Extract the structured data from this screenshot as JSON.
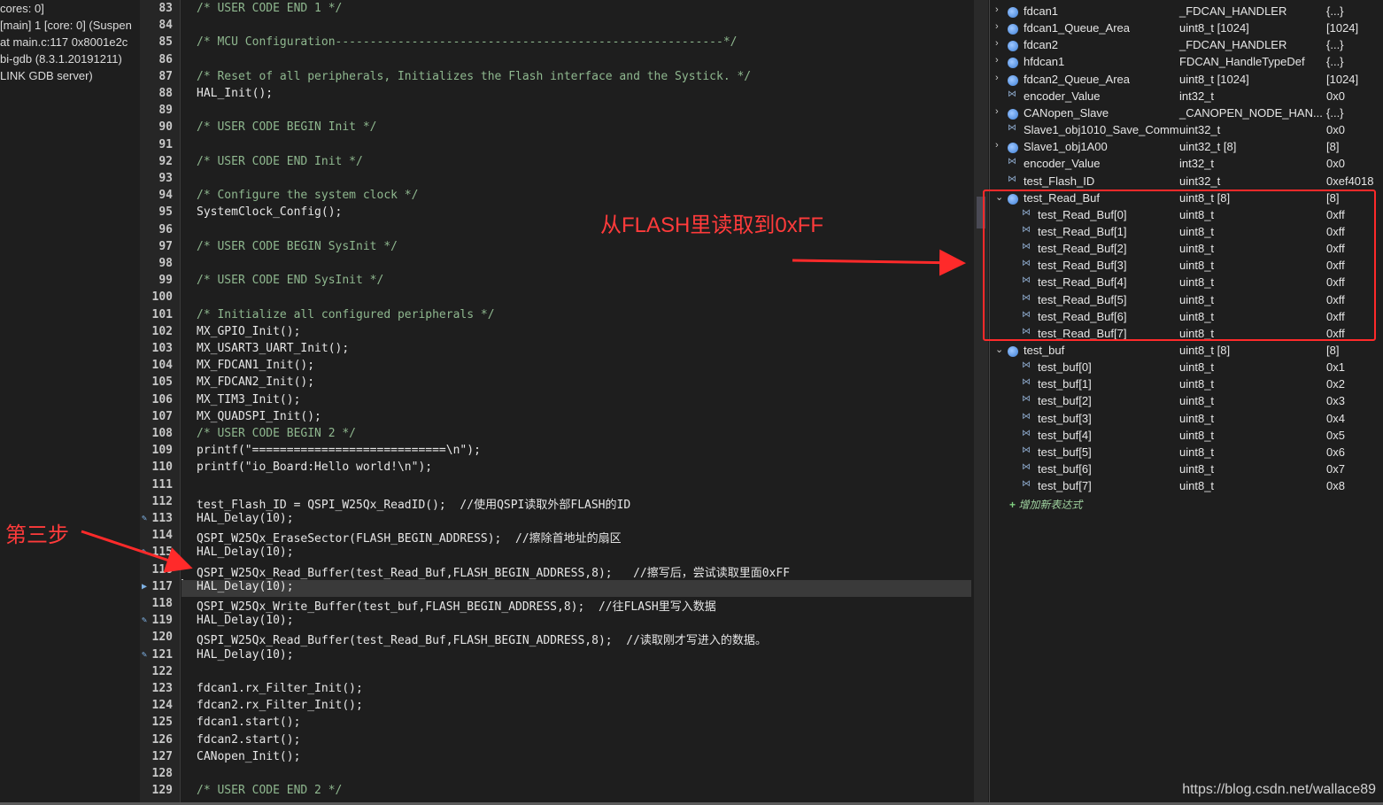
{
  "debug": {
    "lines": [
      "cores: 0]",
      "[main] 1 [core: 0] (Suspen",
      "at main.c:117 0x8001e2c",
      "bi-gdb (8.3.1.20191211)",
      "LINK GDB server)"
    ]
  },
  "editor": {
    "lines": [
      {
        "n": "83",
        "code": "/* USER CODE END 1 */",
        "kind": "comment"
      },
      {
        "n": "84",
        "code": "",
        "kind": "code"
      },
      {
        "n": "85",
        "code": "/* MCU Configuration--------------------------------------------------------*/",
        "kind": "comment"
      },
      {
        "n": "86",
        "code": "",
        "kind": "code"
      },
      {
        "n": "87",
        "code": "/* Reset of all peripherals, Initializes the Flash interface and the Systick. */",
        "kind": "comment"
      },
      {
        "n": "88",
        "code": "HAL_Init();",
        "kind": "code"
      },
      {
        "n": "89",
        "code": "",
        "kind": "code"
      },
      {
        "n": "90",
        "code": "/* USER CODE BEGIN Init */",
        "kind": "comment"
      },
      {
        "n": "91",
        "code": "",
        "kind": "code"
      },
      {
        "n": "92",
        "code": "/* USER CODE END Init */",
        "kind": "comment"
      },
      {
        "n": "93",
        "code": "",
        "kind": "code"
      },
      {
        "n": "94",
        "code": "/* Configure the system clock */",
        "kind": "comment"
      },
      {
        "n": "95",
        "code": "SystemClock_Config();",
        "kind": "code"
      },
      {
        "n": "96",
        "code": "",
        "kind": "code"
      },
      {
        "n": "97",
        "code": "/* USER CODE BEGIN SysInit */",
        "kind": "comment"
      },
      {
        "n": "98",
        "code": "",
        "kind": "code"
      },
      {
        "n": "99",
        "code": "/* USER CODE END SysInit */",
        "kind": "comment"
      },
      {
        "n": "100",
        "code": "",
        "kind": "code"
      },
      {
        "n": "101",
        "code": "/* Initialize all configured peripherals */",
        "kind": "comment"
      },
      {
        "n": "102",
        "code": "MX_GPIO_Init();",
        "kind": "code"
      },
      {
        "n": "103",
        "code": "MX_USART3_UART_Init();",
        "kind": "code"
      },
      {
        "n": "104",
        "code": "MX_FDCAN1_Init();",
        "kind": "code"
      },
      {
        "n": "105",
        "code": "MX_FDCAN2_Init();",
        "kind": "code"
      },
      {
        "n": "106",
        "code": "MX_TIM3_Init();",
        "kind": "code"
      },
      {
        "n": "107",
        "code": "MX_QUADSPI_Init();",
        "kind": "code"
      },
      {
        "n": "108",
        "code": "/* USER CODE BEGIN 2 */",
        "kind": "comment"
      },
      {
        "n": "109",
        "code": "printf(\"============================\\n\");",
        "kind": "code"
      },
      {
        "n": "110",
        "code": "printf(\"io_Board:Hello world!\\n\");",
        "kind": "code"
      },
      {
        "n": "111",
        "code": "",
        "kind": "code"
      },
      {
        "n": "112",
        "code": "test_Flash_ID = QSPI_W25Qx_ReadID();  //使用QSPI读取外部FLASH的ID",
        "kind": "code"
      },
      {
        "n": "113",
        "code": "HAL_Delay(10);",
        "kind": "code",
        "mark": true
      },
      {
        "n": "114",
        "code": "QSPI_W25Qx_EraseSector(FLASH_BEGIN_ADDRESS);  //擦除首地址的扇区",
        "kind": "code"
      },
      {
        "n": "115",
        "code": "HAL_Delay(10);",
        "kind": "code",
        "mark": true
      },
      {
        "n": "116",
        "code": "QSPI_W25Qx_Read_Buffer(test_Read_Buf,FLASH_BEGIN_ADDRESS,8);   //擦写后，尝试读取里面0xFF",
        "kind": "code"
      },
      {
        "n": "117",
        "code": "HAL_Delay(10);",
        "kind": "current",
        "mark": true
      },
      {
        "n": "118",
        "code": "QSPI_W25Qx_Write_Buffer(test_buf,FLASH_BEGIN_ADDRESS,8);  //往FLASH里写入数据",
        "kind": "code"
      },
      {
        "n": "119",
        "code": "HAL_Delay(10);",
        "kind": "code",
        "mark": true
      },
      {
        "n": "120",
        "code": "QSPI_W25Qx_Read_Buffer(test_Read_Buf,FLASH_BEGIN_ADDRESS,8);  //读取刚才写进入的数据。",
        "kind": "code"
      },
      {
        "n": "121",
        "code": "HAL_Delay(10);",
        "kind": "code",
        "mark": true
      },
      {
        "n": "122",
        "code": "",
        "kind": "code"
      },
      {
        "n": "123",
        "code": "fdcan1.rx_Filter_Init();",
        "kind": "code"
      },
      {
        "n": "124",
        "code": "fdcan2.rx_Filter_Init();",
        "kind": "code"
      },
      {
        "n": "125",
        "code": "fdcan1.start();",
        "kind": "code"
      },
      {
        "n": "126",
        "code": "fdcan2.start();",
        "kind": "code"
      },
      {
        "n": "127",
        "code": "CANopen_Init();",
        "kind": "code"
      },
      {
        "n": "128",
        "code": "",
        "kind": "code"
      },
      {
        "n": "129",
        "code": "/* USER CODE END 2 */",
        "kind": "comment"
      }
    ]
  },
  "expressions": {
    "rows": [
      {
        "name": "fdcan1",
        "type": "_FDCAN_HANDLER",
        "value": "{...}",
        "icon": "obj",
        "twisty": "collapsed",
        "child": false
      },
      {
        "name": "fdcan1_Queue_Area",
        "type": "uint8_t [1024]",
        "value": "[1024]",
        "icon": "obj",
        "twisty": "collapsed",
        "child": false
      },
      {
        "name": "fdcan2",
        "type": "_FDCAN_HANDLER",
        "value": "{...}",
        "icon": "obj",
        "twisty": "collapsed",
        "child": false
      },
      {
        "name": "hfdcan1",
        "type": "FDCAN_HandleTypeDef",
        "value": "{...}",
        "icon": "obj",
        "twisty": "collapsed",
        "child": false
      },
      {
        "name": "fdcan2_Queue_Area",
        "type": "uint8_t [1024]",
        "value": "[1024]",
        "icon": "obj",
        "twisty": "collapsed",
        "child": false
      },
      {
        "name": "encoder_Value",
        "type": "int32_t",
        "value": "0x0",
        "icon": "var",
        "twisty": "none",
        "child": false
      },
      {
        "name": "CANopen_Slave",
        "type": "_CANOPEN_NODE_HAN...",
        "value": "{...}",
        "icon": "obj",
        "twisty": "collapsed",
        "child": false
      },
      {
        "name": "Slave1_obj1010_Save_Comm",
        "type": "uint32_t",
        "value": "0x0",
        "icon": "var",
        "twisty": "none",
        "child": false
      },
      {
        "name": "Slave1_obj1A00",
        "type": "uint32_t [8]",
        "value": "[8]",
        "icon": "obj",
        "twisty": "collapsed",
        "child": false
      },
      {
        "name": "encoder_Value",
        "type": "int32_t",
        "value": "0x0",
        "icon": "var",
        "twisty": "none",
        "child": false
      },
      {
        "name": "test_Flash_ID",
        "type": "uint32_t",
        "value": "0xef4018",
        "icon": "var",
        "twisty": "none",
        "child": false
      },
      {
        "name": "test_Read_Buf",
        "type": "uint8_t [8]",
        "value": "[8]",
        "icon": "obj",
        "twisty": "expanded",
        "child": false
      },
      {
        "name": "test_Read_Buf[0]",
        "type": "uint8_t",
        "value": "0xff",
        "icon": "var",
        "twisty": "none",
        "child": true
      },
      {
        "name": "test_Read_Buf[1]",
        "type": "uint8_t",
        "value": "0xff",
        "icon": "var",
        "twisty": "none",
        "child": true
      },
      {
        "name": "test_Read_Buf[2]",
        "type": "uint8_t",
        "value": "0xff",
        "icon": "var",
        "twisty": "none",
        "child": true
      },
      {
        "name": "test_Read_Buf[3]",
        "type": "uint8_t",
        "value": "0xff",
        "icon": "var",
        "twisty": "none",
        "child": true
      },
      {
        "name": "test_Read_Buf[4]",
        "type": "uint8_t",
        "value": "0xff",
        "icon": "var",
        "twisty": "none",
        "child": true
      },
      {
        "name": "test_Read_Buf[5]",
        "type": "uint8_t",
        "value": "0xff",
        "icon": "var",
        "twisty": "none",
        "child": true
      },
      {
        "name": "test_Read_Buf[6]",
        "type": "uint8_t",
        "value": "0xff",
        "icon": "var",
        "twisty": "none",
        "child": true
      },
      {
        "name": "test_Read_Buf[7]",
        "type": "uint8_t",
        "value": "0xff",
        "icon": "var",
        "twisty": "none",
        "child": true
      },
      {
        "name": "test_buf",
        "type": "uint8_t [8]",
        "value": "[8]",
        "icon": "obj",
        "twisty": "expanded",
        "child": false
      },
      {
        "name": "test_buf[0]",
        "type": "uint8_t",
        "value": "0x1",
        "icon": "var",
        "twisty": "none",
        "child": true
      },
      {
        "name": "test_buf[1]",
        "type": "uint8_t",
        "value": "0x2",
        "icon": "var",
        "twisty": "none",
        "child": true
      },
      {
        "name": "test_buf[2]",
        "type": "uint8_t",
        "value": "0x3",
        "icon": "var",
        "twisty": "none",
        "child": true
      },
      {
        "name": "test_buf[3]",
        "type": "uint8_t",
        "value": "0x4",
        "icon": "var",
        "twisty": "none",
        "child": true
      },
      {
        "name": "test_buf[4]",
        "type": "uint8_t",
        "value": "0x5",
        "icon": "var",
        "twisty": "none",
        "child": true
      },
      {
        "name": "test_buf[5]",
        "type": "uint8_t",
        "value": "0x6",
        "icon": "var",
        "twisty": "none",
        "child": true
      },
      {
        "name": "test_buf[6]",
        "type": "uint8_t",
        "value": "0x7",
        "icon": "var",
        "twisty": "none",
        "child": true
      },
      {
        "name": "test_buf[7]",
        "type": "uint8_t",
        "value": "0x8",
        "icon": "var",
        "twisty": "none",
        "child": true
      }
    ],
    "add_label": "增加新表达式"
  },
  "annotations": {
    "read_ff_note": "从FLASH里读取到0xFF",
    "step_label": "第三步",
    "color": "#ff2a2a"
  },
  "watermark": "https://blog.csdn.net/wallace89"
}
